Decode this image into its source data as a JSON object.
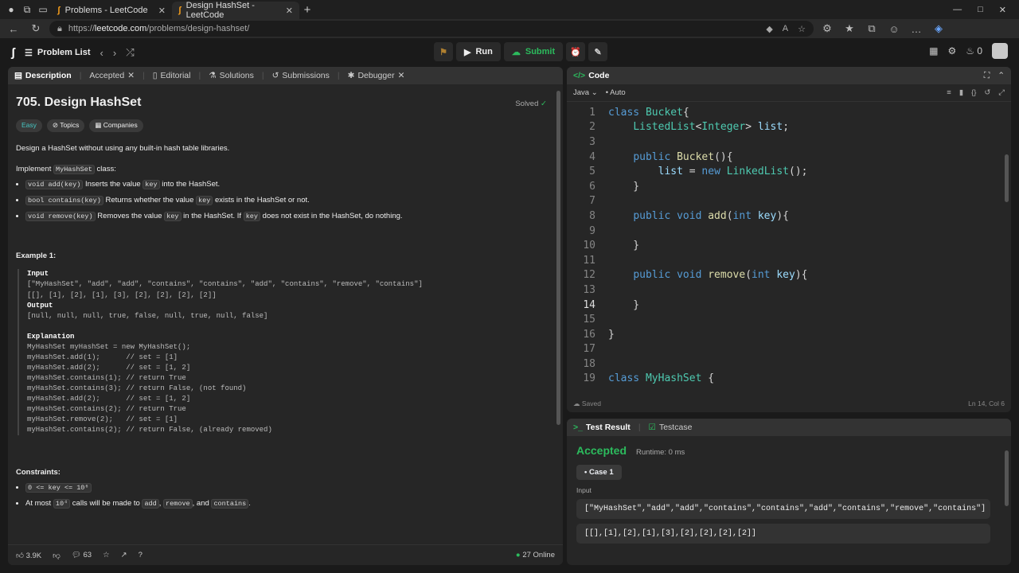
{
  "browser": {
    "tabs": [
      {
        "title": "Problems - LeetCode"
      },
      {
        "title": "Design HashSet - LeetCode"
      }
    ],
    "url_prefix": "https://",
    "url_host": "leetcode.com",
    "url_path": "/problems/design-hashset/"
  },
  "header": {
    "problem_list": "Problem List",
    "run": "Run",
    "submit": "Submit",
    "streak": "0"
  },
  "desc_tabs": [
    {
      "label": "Description"
    },
    {
      "label": "Accepted"
    },
    {
      "label": "Editorial"
    },
    {
      "label": "Solutions"
    },
    {
      "label": "Submissions"
    },
    {
      "label": "Debugger"
    }
  ],
  "problem": {
    "title": "705. Design HashSet",
    "solved": "Solved",
    "difficulty": "Easy",
    "topics": "Topics",
    "companies": "Companies",
    "intro": "Design a HashSet without using any built-in hash table libraries.",
    "implement_pre": "Implement ",
    "implement_code": "MyHashSet",
    "implement_post": " class:",
    "m1_code": "void add(key)",
    "m1_a": " Inserts the value ",
    "m1_key": "key",
    "m1_b": " into the HashSet.",
    "m2_code": "bool contains(key)",
    "m2_a": " Returns whether the value ",
    "m2_key": "key",
    "m2_b": " exists in the HashSet or not.",
    "m3_code": "void remove(key)",
    "m3_a": " Removes the value ",
    "m3_key": "key",
    "m3_b": " in the HashSet. If ",
    "m3_key2": "key",
    "m3_c": " does not exist in the HashSet, do nothing.",
    "example_title": "Example 1:",
    "input_label": "Input",
    "input_l1": "[\"MyHashSet\", \"add\", \"add\", \"contains\", \"contains\", \"add\", \"contains\", \"remove\", \"contains\"]",
    "input_l2": "[[], [1], [2], [1], [3], [2], [2], [2], [2]]",
    "output_label": "Output",
    "output_l1": "[null, null, null, true, false, null, true, null, false]",
    "explanation_label": "Explanation",
    "explanation": "MyHashSet myHashSet = new MyHashSet();\nmyHashSet.add(1);      // set = [1]\nmyHashSet.add(2);      // set = [1, 2]\nmyHashSet.contains(1); // return True\nmyHashSet.contains(3); // return False, (not found)\nmyHashSet.add(2);      // set = [1, 2]\nmyHashSet.contains(2); // return True\nmyHashSet.remove(2);   // set = [1]\nmyHashSet.contains(2); // return False, (already removed)",
    "constraints_title": "Constraints:",
    "c1": "0 <= key <= 10⁶",
    "c2_a": "At most ",
    "c2_code": "10⁴",
    "c2_b": " calls will be made to ",
    "c2_add": "add",
    "c2_c": ", ",
    "c2_remove": "remove",
    "c2_d": ", and ",
    "c2_contains": "contains",
    "c2_e": "."
  },
  "footer": {
    "likes": "3.9K",
    "comments": "63",
    "online_count": "27",
    "online_label": "Online"
  },
  "code_panel": {
    "title": "Code",
    "language": "Java",
    "auto": "Auto",
    "saved": "Saved",
    "cursor": "Ln 14, Col 6"
  },
  "code_lines": [
    {
      "n": "1",
      "tokens": [
        [
          "kw",
          "class "
        ],
        [
          "ty",
          "Bucket"
        ],
        [
          "p",
          "{"
        ]
      ]
    },
    {
      "n": "2",
      "tokens": [
        [
          "p",
          "    "
        ],
        [
          "ty",
          "ListedList"
        ],
        [
          "p",
          "<"
        ],
        [
          "ty",
          "Integer"
        ],
        [
          "p",
          "> "
        ],
        [
          "vr",
          "list"
        ],
        [
          "p",
          ";"
        ]
      ]
    },
    {
      "n": "3",
      "tokens": []
    },
    {
      "n": "4",
      "tokens": [
        [
          "p",
          "    "
        ],
        [
          "kw",
          "public "
        ],
        [
          "fn",
          "Bucket"
        ],
        [
          "p",
          "(){"
        ]
      ]
    },
    {
      "n": "5",
      "tokens": [
        [
          "p",
          "        "
        ],
        [
          "vr",
          "list"
        ],
        [
          "p",
          " = "
        ],
        [
          "kw",
          "new "
        ],
        [
          "ty",
          "LinkedList"
        ],
        [
          "p",
          "();"
        ]
      ]
    },
    {
      "n": "6",
      "tokens": [
        [
          "p",
          "    }"
        ]
      ]
    },
    {
      "n": "7",
      "tokens": []
    },
    {
      "n": "8",
      "tokens": [
        [
          "p",
          "    "
        ],
        [
          "kw",
          "public void "
        ],
        [
          "fn",
          "add"
        ],
        [
          "p",
          "("
        ],
        [
          "kw",
          "int "
        ],
        [
          "vr",
          "key"
        ],
        [
          "p",
          "){"
        ]
      ]
    },
    {
      "n": "9",
      "tokens": []
    },
    {
      "n": "10",
      "tokens": [
        [
          "p",
          "    }"
        ]
      ]
    },
    {
      "n": "11",
      "tokens": []
    },
    {
      "n": "12",
      "tokens": [
        [
          "p",
          "    "
        ],
        [
          "kw",
          "public void "
        ],
        [
          "fn",
          "remove"
        ],
        [
          "p",
          "("
        ],
        [
          "kw",
          "int "
        ],
        [
          "vr",
          "key"
        ],
        [
          "p",
          "){"
        ]
      ]
    },
    {
      "n": "13",
      "tokens": []
    },
    {
      "n": "14",
      "tokens": [
        [
          "p",
          "    }"
        ]
      ]
    },
    {
      "n": "15",
      "tokens": []
    },
    {
      "n": "16",
      "tokens": [
        [
          "p",
          "}"
        ]
      ]
    },
    {
      "n": "17",
      "tokens": []
    },
    {
      "n": "18",
      "tokens": []
    },
    {
      "n": "19",
      "tokens": [
        [
          "kw",
          "class "
        ],
        [
          "ty",
          "MyHashSet "
        ],
        [
          "p",
          "{"
        ]
      ]
    }
  ],
  "test_panel": {
    "tab_result": "Test Result",
    "tab_testcase": "Testcase",
    "status": "Accepted",
    "runtime": "Runtime: 0 ms",
    "case": "Case 1",
    "input_label": "Input",
    "input1": "[\"MyHashSet\",\"add\",\"add\",\"contains\",\"contains\",\"add\",\"contains\",\"remove\",\"contains\"]",
    "input2": "[[],[1],[2],[1],[3],[2],[2],[2],[2]]"
  },
  "colors": {
    "accent_green": "#2cbb5d",
    "easy": "#46c6c2",
    "brand": "#f89f1b"
  }
}
